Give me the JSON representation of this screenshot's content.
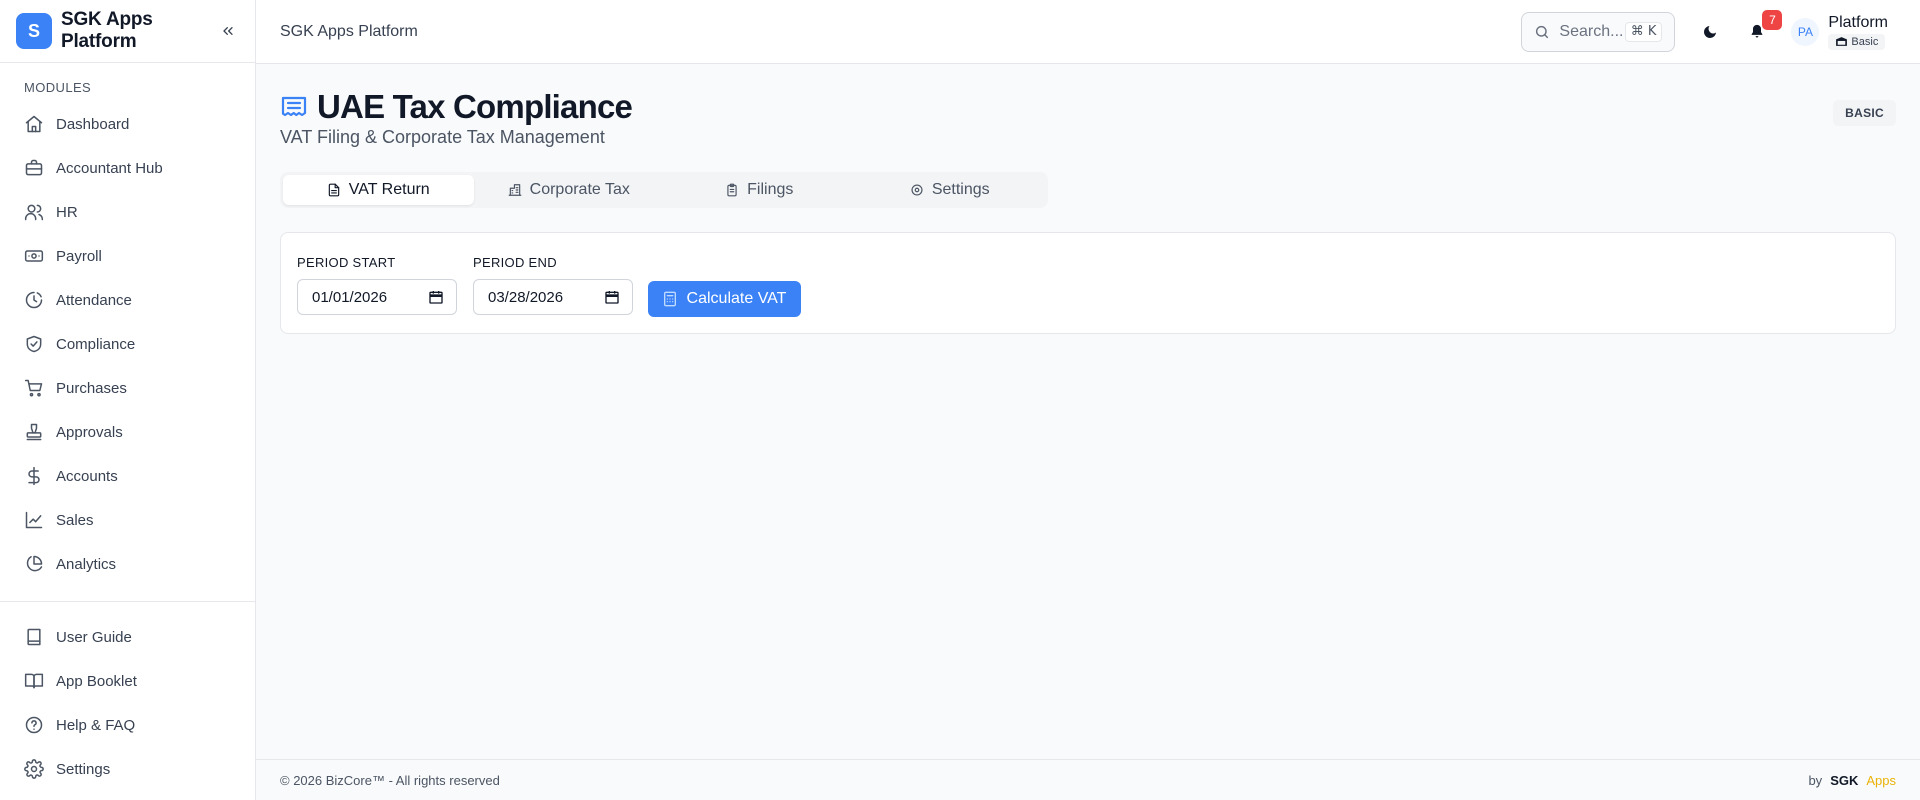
{
  "brand": {
    "logo_letter": "S",
    "name": "SGK Apps Platform"
  },
  "sidebar": {
    "section_label": "MODULES",
    "items": [
      {
        "label": "Dashboard",
        "icon": "home-icon"
      },
      {
        "label": "Accountant Hub",
        "icon": "briefcase-icon"
      },
      {
        "label": "HR",
        "icon": "users-icon"
      },
      {
        "label": "Payroll",
        "icon": "banknote-icon"
      },
      {
        "label": "Attendance",
        "icon": "clock-icon"
      },
      {
        "label": "Compliance",
        "icon": "shield-check-icon"
      },
      {
        "label": "Purchases",
        "icon": "shopping-cart-icon"
      },
      {
        "label": "Approvals",
        "icon": "stamp-icon"
      },
      {
        "label": "Accounts",
        "icon": "dollar-icon"
      },
      {
        "label": "Sales",
        "icon": "trending-up-icon"
      },
      {
        "label": "Analytics",
        "icon": "pie-chart-icon"
      }
    ],
    "bottom_items": [
      {
        "label": "User Guide",
        "icon": "book-icon"
      },
      {
        "label": "App Booklet",
        "icon": "book-open-icon"
      },
      {
        "label": "Help & FAQ",
        "icon": "help-circle-icon"
      },
      {
        "label": "Settings",
        "icon": "gear-icon"
      }
    ]
  },
  "topbar": {
    "title": "SGK Apps Platform",
    "search_placeholder": "Search...",
    "search_shortcut": "⌘ K",
    "notification_count": "7",
    "avatar_initials": "PA",
    "user_name": "Platform",
    "plan": "Basic"
  },
  "page": {
    "title": "UAE Tax Compliance",
    "subtitle": "VAT Filing & Corporate Tax Management",
    "tier_badge": "BASIC",
    "tabs": [
      {
        "label": "VAT Return",
        "icon": "file-text-icon",
        "active": true
      },
      {
        "label": "Corporate Tax",
        "icon": "landmark-icon",
        "active": false
      },
      {
        "label": "Filings",
        "icon": "clipboard-icon",
        "active": false
      },
      {
        "label": "Settings",
        "icon": "gear-icon",
        "active": false
      }
    ],
    "form": {
      "period_start_label": "PERIOD START",
      "period_start_value": "01/01/2026",
      "period_end_label": "PERIOD END",
      "period_end_value": "03/28/2026",
      "calculate_label": "Calculate VAT"
    }
  },
  "footer": {
    "copyright": "© 2026 BizCore™ - All rights reserved",
    "by": "by",
    "brand_primary": "SGK",
    "brand_secondary": "Apps"
  },
  "colors": {
    "accent": "#3b82f6",
    "badge": "#ef4444",
    "brand_secondary": "#eab308"
  }
}
